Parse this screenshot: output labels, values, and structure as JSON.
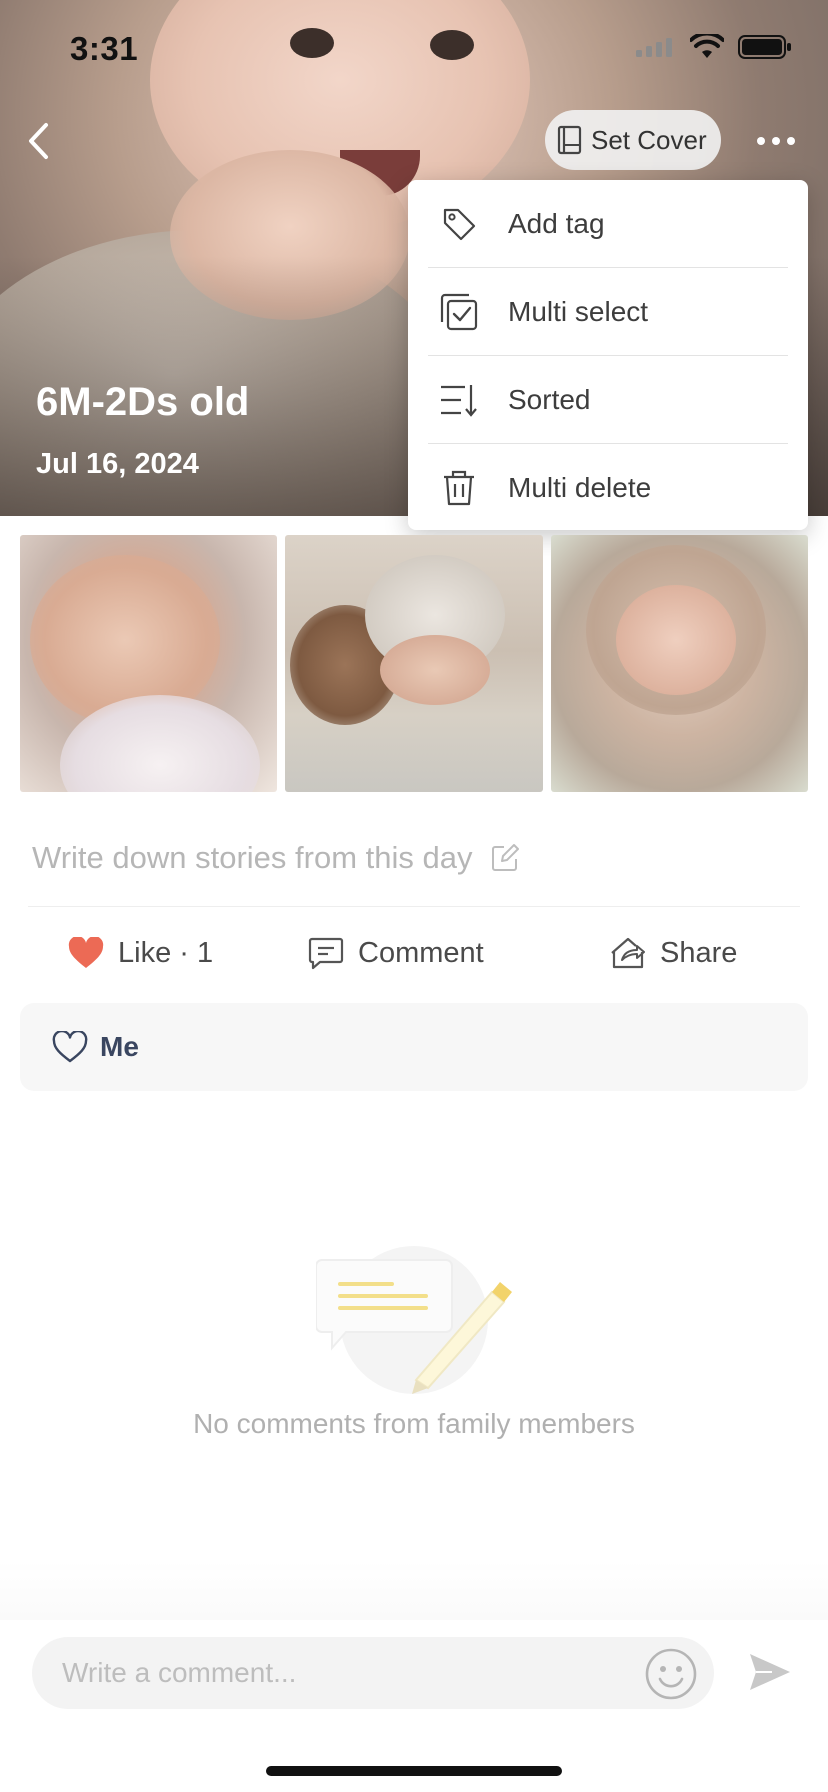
{
  "status_bar": {
    "time": "3:31"
  },
  "header": {
    "set_cover_label": "Set Cover"
  },
  "cover": {
    "title": "6M-2Ds old",
    "date": "Jul 16, 2024"
  },
  "menu": {
    "items": [
      {
        "label": "Add tag",
        "icon": "tag-icon"
      },
      {
        "label": "Multi select",
        "icon": "multi-select-icon"
      },
      {
        "label": "Sorted",
        "icon": "sort-icon"
      },
      {
        "label": "Multi delete",
        "icon": "trash-icon"
      }
    ]
  },
  "photos": [
    {
      "alt": "photo-1"
    },
    {
      "alt": "photo-2"
    },
    {
      "alt": "photo-3"
    }
  ],
  "story": {
    "placeholder": "Write down stories from this day"
  },
  "actions": {
    "like_label": "Like · 1",
    "comment_label": "Comment",
    "share_label": "Share"
  },
  "likes": {
    "user": "Me"
  },
  "empty_state": {
    "text": "No comments from family members"
  },
  "comment_input": {
    "placeholder": "Write a comment..."
  },
  "colors": {
    "like": "#ec6a55",
    "text_muted": "#b0b0b0",
    "likes_name": "#3a4660"
  }
}
